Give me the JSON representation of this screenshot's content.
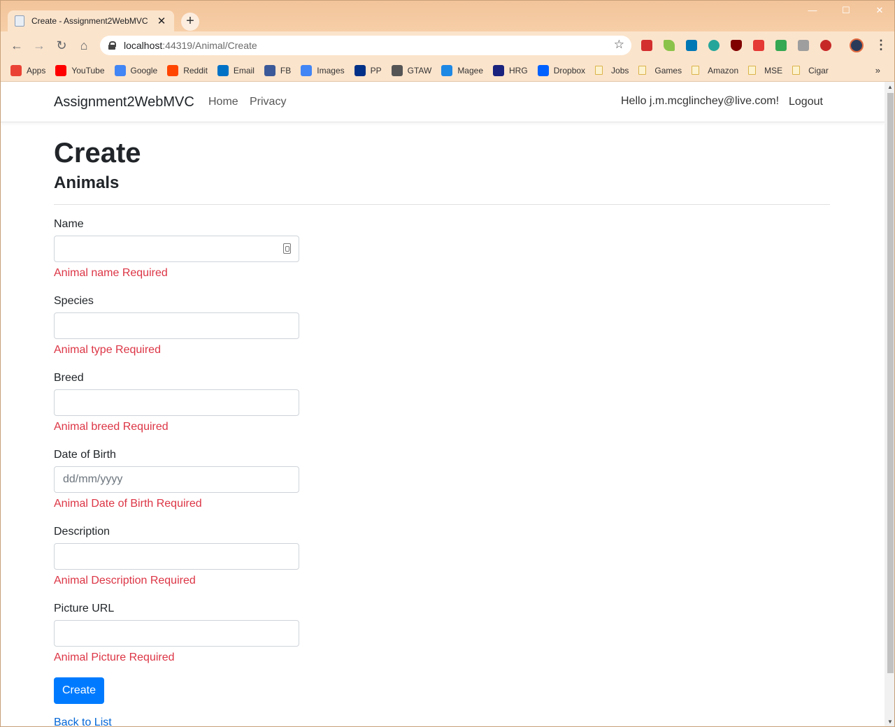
{
  "browser": {
    "tab_title": "Create - Assignment2WebMVC",
    "new_tab": "+",
    "url_host": "localhost",
    "url_rest": ":44319/Animal/Create",
    "bookmarks": [
      {
        "label": "Apps",
        "icon": "apps-grid-icon",
        "color": "#ea4335"
      },
      {
        "label": "YouTube",
        "icon": "youtube-icon",
        "color": "#ff0000"
      },
      {
        "label": "Google",
        "icon": "google-icon",
        "color": "#4285f4"
      },
      {
        "label": "Reddit",
        "icon": "reddit-icon",
        "color": "#ff4500"
      },
      {
        "label": "Email",
        "icon": "outlook-icon",
        "color": "#0072c6"
      },
      {
        "label": "FB",
        "icon": "facebook-icon",
        "color": "#3b5998"
      },
      {
        "label": "Images",
        "icon": "google-icon",
        "color": "#4285f4"
      },
      {
        "label": "PP",
        "icon": "paypal-icon",
        "color": "#003087"
      },
      {
        "label": "GTAW",
        "icon": "globe-icon",
        "color": "#555555"
      },
      {
        "label": "Magee",
        "icon": "magee-icon",
        "color": "#1e88e5"
      },
      {
        "label": "HRG",
        "icon": "hg-icon",
        "color": "#1a237e"
      },
      {
        "label": "Dropbox",
        "icon": "dropbox-icon",
        "color": "#0061ff"
      },
      {
        "label": "Jobs",
        "icon": "folder-icon"
      },
      {
        "label": "Games",
        "icon": "folder-icon"
      },
      {
        "label": "Amazon",
        "icon": "folder-icon"
      },
      {
        "label": "MSE",
        "icon": "folder-icon"
      },
      {
        "label": "Cigar",
        "icon": "folder-icon"
      }
    ],
    "bookmarks_more": "»"
  },
  "site": {
    "brand": "Assignment2WebMVC",
    "nav": [
      "Home",
      "Privacy"
    ],
    "greeting": "Hello j.m.mcglinchey@live.com!",
    "logout": "Logout"
  },
  "page": {
    "title": "Create",
    "subtitle": "Animals",
    "fields": [
      {
        "label": "Name",
        "value": "",
        "placeholder": "",
        "error": "Animal name Required"
      },
      {
        "label": "Species",
        "value": "",
        "placeholder": "",
        "error": "Animal type Required"
      },
      {
        "label": "Breed",
        "value": "",
        "placeholder": "",
        "error": "Animal breed Required"
      },
      {
        "label": "Date of Birth",
        "value": "",
        "placeholder": "dd/mm/yyyy",
        "error": "Animal Date of Birth Required"
      },
      {
        "label": "Description",
        "value": "",
        "placeholder": "",
        "error": "Animal Description Required"
      },
      {
        "label": "Picture URL",
        "value": "",
        "placeholder": "",
        "error": "Animal Picture Required"
      }
    ],
    "submit_label": "Create",
    "back_link": "Back to List"
  },
  "colors": {
    "error": "#dc3545",
    "primary_button": "#007bff",
    "link": "#0366d6"
  }
}
